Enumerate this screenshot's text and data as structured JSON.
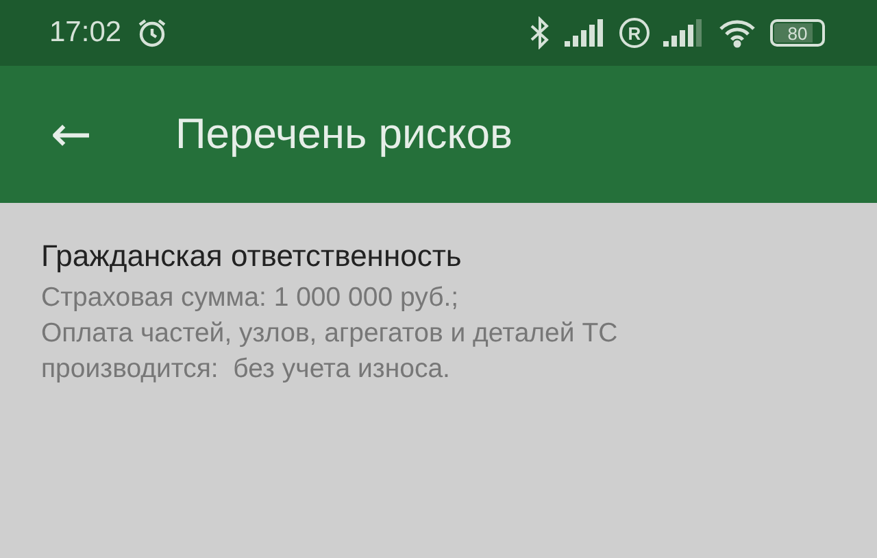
{
  "status_bar": {
    "time": "17:02",
    "roaming_indicator": "R",
    "battery": "80"
  },
  "app_bar": {
    "back": "←",
    "title": "Перечень рисков"
  },
  "risks": [
    {
      "title": "Гражданская ответственность",
      "details": [
        "Страховая сумма: 1 000 000 руб.;",
        "Оплата частей, узлов, агрегатов и деталей ТС",
        "производится:  без учета износа."
      ]
    }
  ]
}
